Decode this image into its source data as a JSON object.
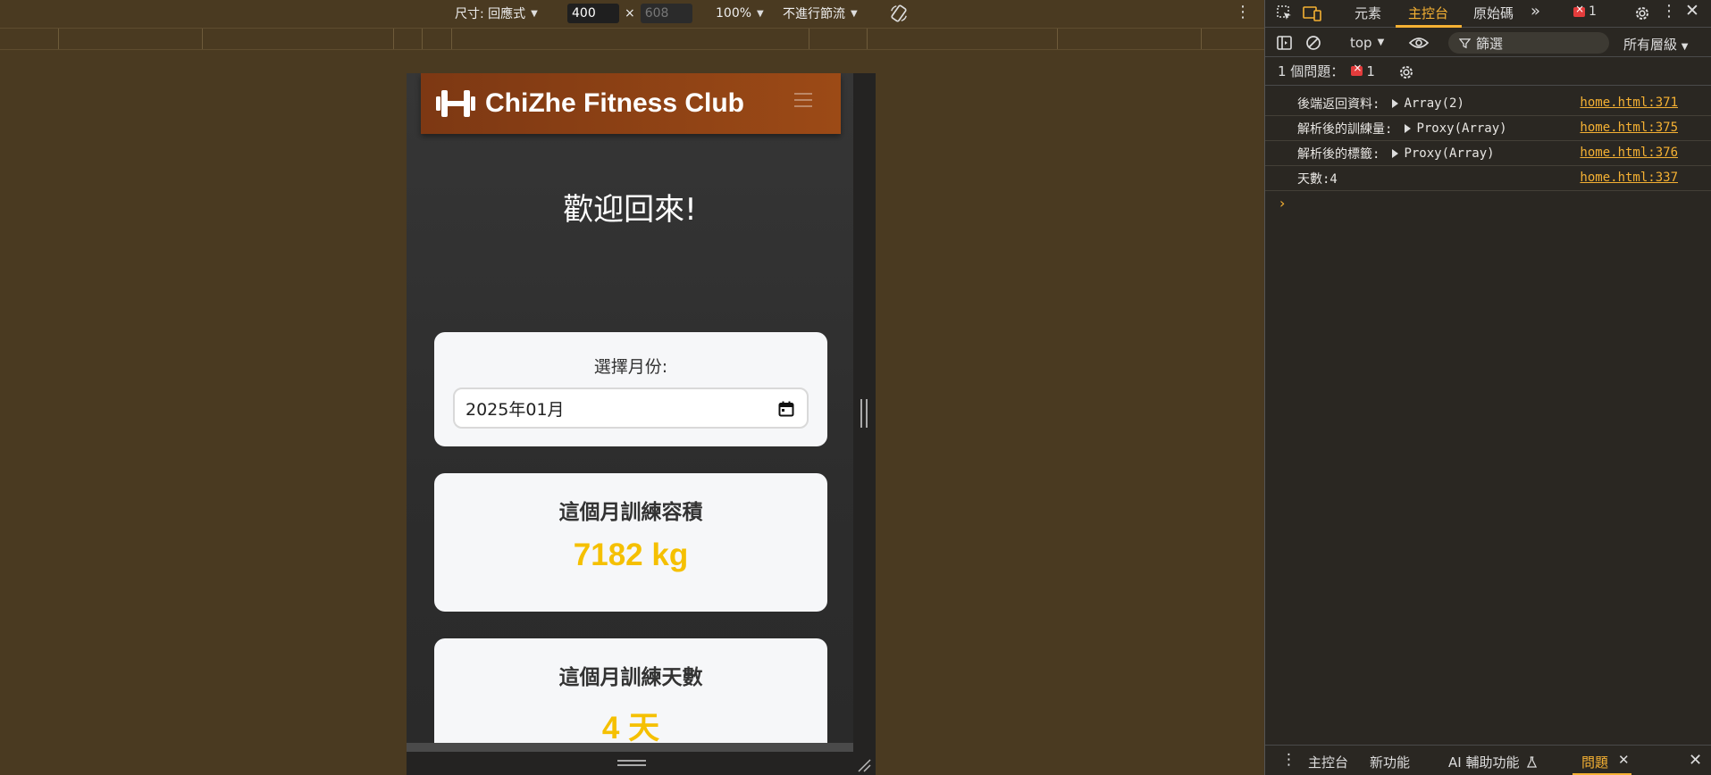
{
  "device_toolbar": {
    "dimensions_label": "尺寸: 回應式",
    "width_value": "400",
    "height_value": "608",
    "times_sign": "×",
    "zoom": "100%",
    "throttling": "不進行節流"
  },
  "app": {
    "brand": "ChiZhe Fitness Club",
    "welcome": "歡迎回來!",
    "month_label": "選擇月份:",
    "month_value": "2025年01月",
    "volume_title": "這個月訓練容積",
    "volume_value": "7182 kg",
    "days_title": "這個月訓練天數",
    "days_value": "4 天"
  },
  "devtools": {
    "tabs": [
      "元素",
      "主控台",
      "原始碼"
    ],
    "active_tab": "主控台",
    "error_count": "1",
    "context": "top",
    "filter_placeholder": "篩選",
    "levels": "所有層級",
    "issues_label": "1 個問題：",
    "issues_count": "1",
    "console_rows": [
      {
        "label": "後端返回資料:",
        "value": "Array(2)",
        "link": "home.html:371",
        "expandable": true
      },
      {
        "label": "解析後的訓練量:",
        "value": "Proxy(Array)",
        "link": "home.html:375",
        "expandable": true
      },
      {
        "label": "解析後的標籤:",
        "value": "Proxy(Array)",
        "link": "home.html:376",
        "expandable": true
      },
      {
        "label": "天數:4",
        "value": "",
        "link": "home.html:337",
        "expandable": false
      }
    ],
    "drawer_tabs": {
      "console": "主控台",
      "whats_new": "新功能",
      "ai": "AI 輔助功能",
      "issues": "問題"
    }
  },
  "colors": {
    "accent": "#f5b133",
    "navbar": "#8e4215",
    "value_yellow": "#f5c000",
    "error": "#e43c3c"
  }
}
